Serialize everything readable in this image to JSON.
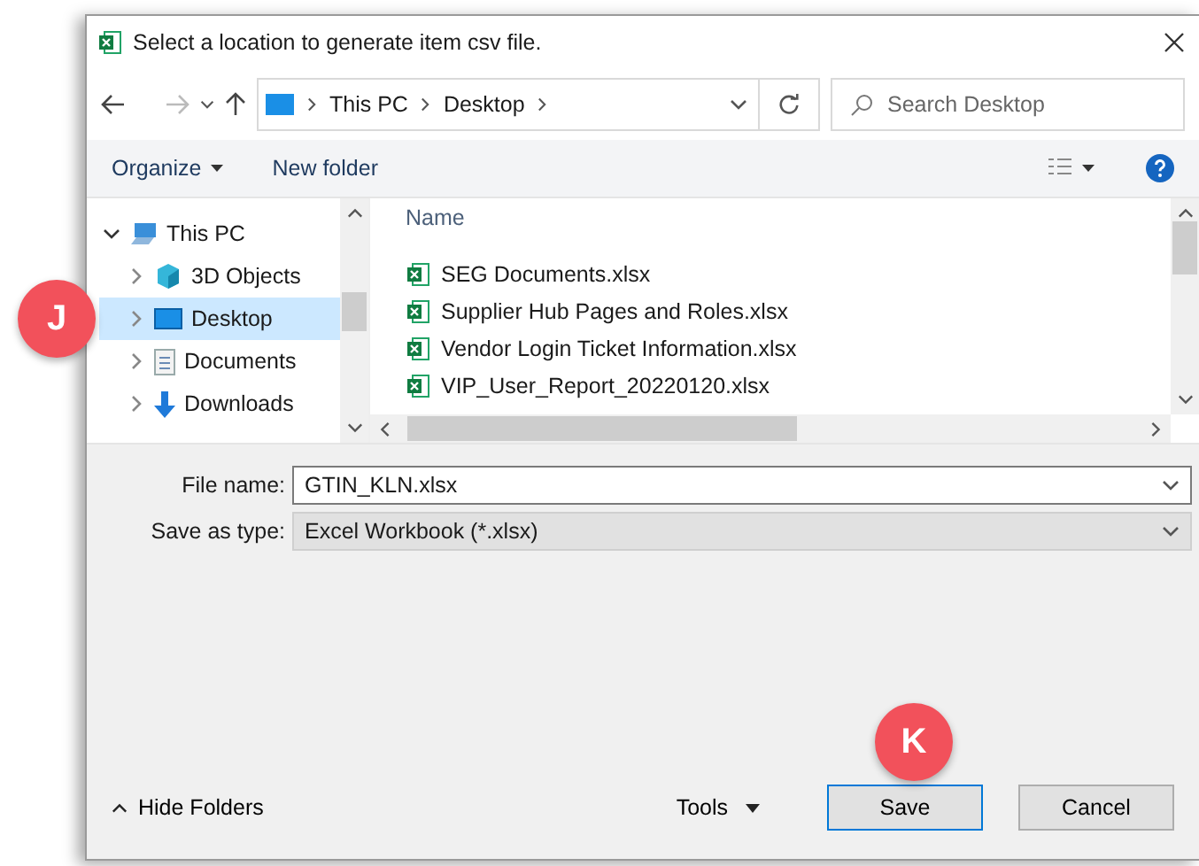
{
  "window": {
    "title": "Select a location to generate item csv file."
  },
  "address": {
    "crumbs": [
      "This PC",
      "Desktop"
    ]
  },
  "search": {
    "placeholder": "Search Desktop"
  },
  "toolbar": {
    "organize": "Organize",
    "new_folder": "New folder"
  },
  "tree": [
    {
      "label": "This PC",
      "kind": "pc",
      "expanded": true,
      "selected": false,
      "children": [
        {
          "label": "3D Objects",
          "kind": "cube",
          "expanded": false,
          "selected": false
        },
        {
          "label": "Desktop",
          "kind": "desktop",
          "expanded": false,
          "selected": true
        },
        {
          "label": "Documents",
          "kind": "documents",
          "expanded": false,
          "selected": false
        },
        {
          "label": "Downloads",
          "kind": "downloads",
          "expanded": false,
          "selected": false
        }
      ]
    }
  ],
  "file_list": {
    "column": "Name",
    "files": [
      "SEG Documents.xlsx",
      "Supplier Hub Pages and Roles.xlsx",
      "Vendor Login Ticket Information.xlsx",
      "VIP_User_Report_20220120.xlsx"
    ]
  },
  "fields": [
    {
      "label": "File name:",
      "value": "GTIN_KLN.xlsx",
      "kind": "input"
    },
    {
      "label": "Save as type:",
      "value": "Excel Workbook (*.xlsx)",
      "kind": "select"
    }
  ],
  "footer": {
    "hide_folders": "Hide Folders",
    "tools": "Tools",
    "buttons": [
      {
        "label": "Save",
        "default": true
      },
      {
        "label": "Cancel",
        "default": false
      }
    ]
  },
  "callouts": [
    {
      "label": "J"
    },
    {
      "label": "K"
    }
  ]
}
